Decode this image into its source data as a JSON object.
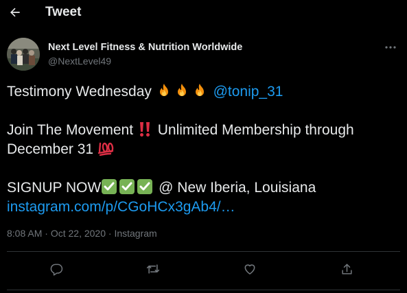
{
  "header": {
    "back_icon": "arrow-left-icon",
    "title": "Tweet"
  },
  "author": {
    "avatar_icon": "avatar-photo",
    "name": "Next Level Fitness & Nutrition Worldwide",
    "handle": "@NextLevel49",
    "more_icon": "more-horizontal-icon"
  },
  "tweet": {
    "line1": "Testimony Wednesday",
    "mention": "@tonip_31",
    "line2_text": "Join The Movement",
    "line2_rest": "Unlimited Membership through",
    "line3": "December 31",
    "line4_text": "SIGNUP NOW",
    "line4_rest": "@ New Iberia, Louisiana",
    "link": "instagram.com/p/CGoHCx3gAb4/…"
  },
  "meta": {
    "time": "8:08 AM",
    "sep1": "·",
    "date": "Oct 22, 2020",
    "sep2": "·",
    "source": "Instagram"
  },
  "actions": {
    "reply_icon": "reply-icon",
    "retweet_icon": "retweet-icon",
    "like_icon": "heart-icon",
    "share_icon": "share-icon"
  },
  "colors": {
    "background": "#000000",
    "text": "#e7e9ea",
    "secondary": "#71767b",
    "link": "#1d9bf0",
    "divider": "#2f3336"
  }
}
